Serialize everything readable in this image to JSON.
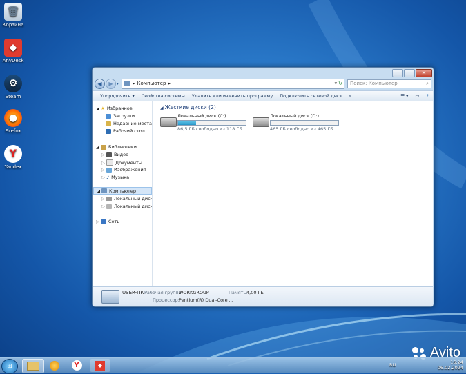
{
  "desktop": {
    "icons": [
      {
        "label": "Корзина"
      },
      {
        "label": "AnyDesk"
      },
      {
        "label": "Steam"
      },
      {
        "label": "Firefox"
      },
      {
        "label": "Yandex"
      }
    ]
  },
  "window": {
    "address": "Компьютер",
    "search_placeholder": "Поиск: Компьютер",
    "toolbar": {
      "organize": "Упорядочить ▾",
      "system_properties": "Свойства системы",
      "uninstall": "Удалить или изменить программу",
      "map_drive": "Подключить сетевой диск",
      "more": "»"
    },
    "nav": {
      "favorites": "Избранное",
      "downloads": "Загрузки",
      "recent": "Недавние места",
      "desktop": "Рабочий стол",
      "libraries": "Библиотеки",
      "video": "Видео",
      "documents": "Документы",
      "images": "Изображения",
      "music": "Музыка",
      "computer": "Компьютер",
      "drive_c": "Локальный диск (C",
      "drive_d": "Локальный диск (D",
      "network": "Сеть"
    },
    "group_title": "Жесткие диски (2)",
    "drives": [
      {
        "name": "Локальный диск (C:)",
        "free_text": "86,5 ГБ свободно из 118 ГБ",
        "used_fraction": 0.27
      },
      {
        "name": "Локальный диск (D:)",
        "free_text": "465 ГБ свободно из 465 ГБ",
        "used_fraction": 0.0
      }
    ],
    "details": {
      "pc_name": "USER-ПК",
      "workgroup_label": "Рабочая группа:",
      "workgroup": "WORKGROUP",
      "memory_label": "Память:",
      "memory": "4,00 ГБ",
      "cpu_label": "Процессор:",
      "cpu": "Pentium(R) Dual-Core ..."
    }
  },
  "taskbar": {
    "lang": "RU",
    "time": "16:24",
    "date": "06.02.2024"
  },
  "watermark": "Avito"
}
